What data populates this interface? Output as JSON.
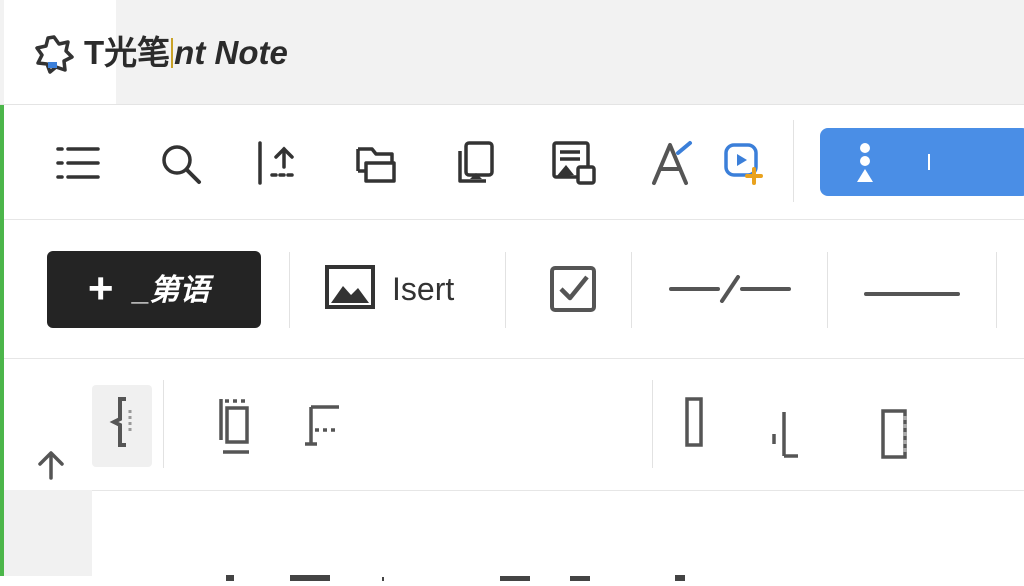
{
  "window": {
    "title_prefix": "T光笔",
    "title_suffix": "nt Note"
  },
  "toolbar": {
    "icons": [
      "menu-icon",
      "search-icon",
      "upload-icon",
      "folder-icon",
      "copy-icon",
      "image-gallery-icon",
      "text-style-icon",
      "add-media-icon"
    ],
    "primary_button_color": "#4a8ee6"
  },
  "editbar": {
    "new_plus": "+",
    "new_label": "_第语",
    "insert_label": "Isert"
  },
  "layout_tools": {
    "icons": [
      "brace-icon",
      "frame-icon",
      "corner-icon",
      "column-icon",
      "align-bottom-icon",
      "panel-icon"
    ]
  },
  "nav": {
    "up_icon": "arrow-up-icon"
  },
  "colors": {
    "accent": "#4a8ee6",
    "frame": "#4cb64a",
    "dark_button": "#242424"
  }
}
